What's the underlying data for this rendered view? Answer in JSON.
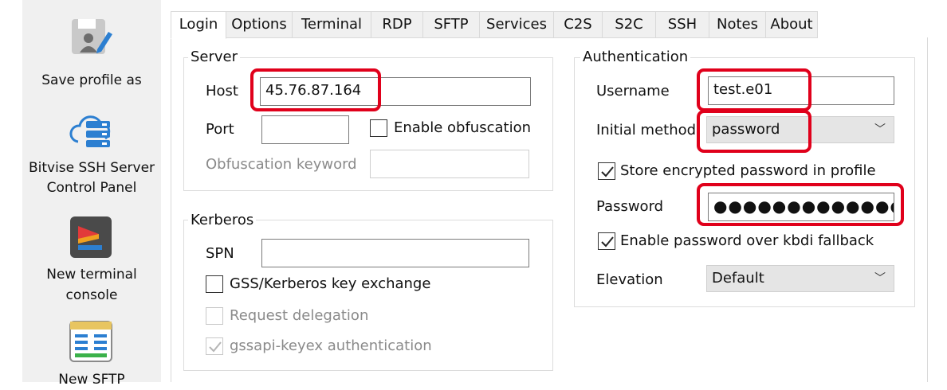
{
  "sidebar": {
    "items": [
      {
        "label": "Save profile as",
        "icon": "save-profile-icon"
      },
      {
        "label_line1": "Bitvise SSH Server",
        "label_line2": "Control Panel",
        "icon": "server-control-panel-icon"
      },
      {
        "label_line1": "New terminal",
        "label_line2": "console",
        "icon": "terminal-console-icon"
      },
      {
        "label": "New SFTP",
        "icon": "sftp-window-icon"
      }
    ]
  },
  "tabs": [
    "Login",
    "Options",
    "Terminal",
    "RDP",
    "SFTP",
    "Services",
    "C2S",
    "S2C",
    "SSH",
    "Notes",
    "About"
  ],
  "server": {
    "title": "Server",
    "host_label": "Host",
    "host_value": "45.76.87.164",
    "port_label": "Port",
    "port_value": "",
    "obfuscation_label": "Enable obfuscation",
    "obf_keyword_label": "Obfuscation keyword",
    "obf_keyword_value": ""
  },
  "kerberos": {
    "title": "Kerberos",
    "spn_label": "SPN",
    "spn_value": "",
    "gss_label": "GSS/Kerberos key exchange",
    "delegation_label": "Request delegation",
    "gssapi_label": "gssapi-keyex authentication"
  },
  "auth": {
    "title": "Authentication",
    "username_label": "Username",
    "username_value": "test.e01",
    "method_label": "Initial method",
    "method_value": "password",
    "store_pw_label": "Store encrypted password in profile",
    "password_label": "Password",
    "password_value": "●●●●●●●●●●●●●●●●",
    "kbdi_label": "Enable password over kbdi fallback",
    "elevation_label": "Elevation",
    "elevation_value": "Default"
  },
  "colors": {
    "highlight": "#e0001b",
    "accent": "#2c7fd1"
  }
}
